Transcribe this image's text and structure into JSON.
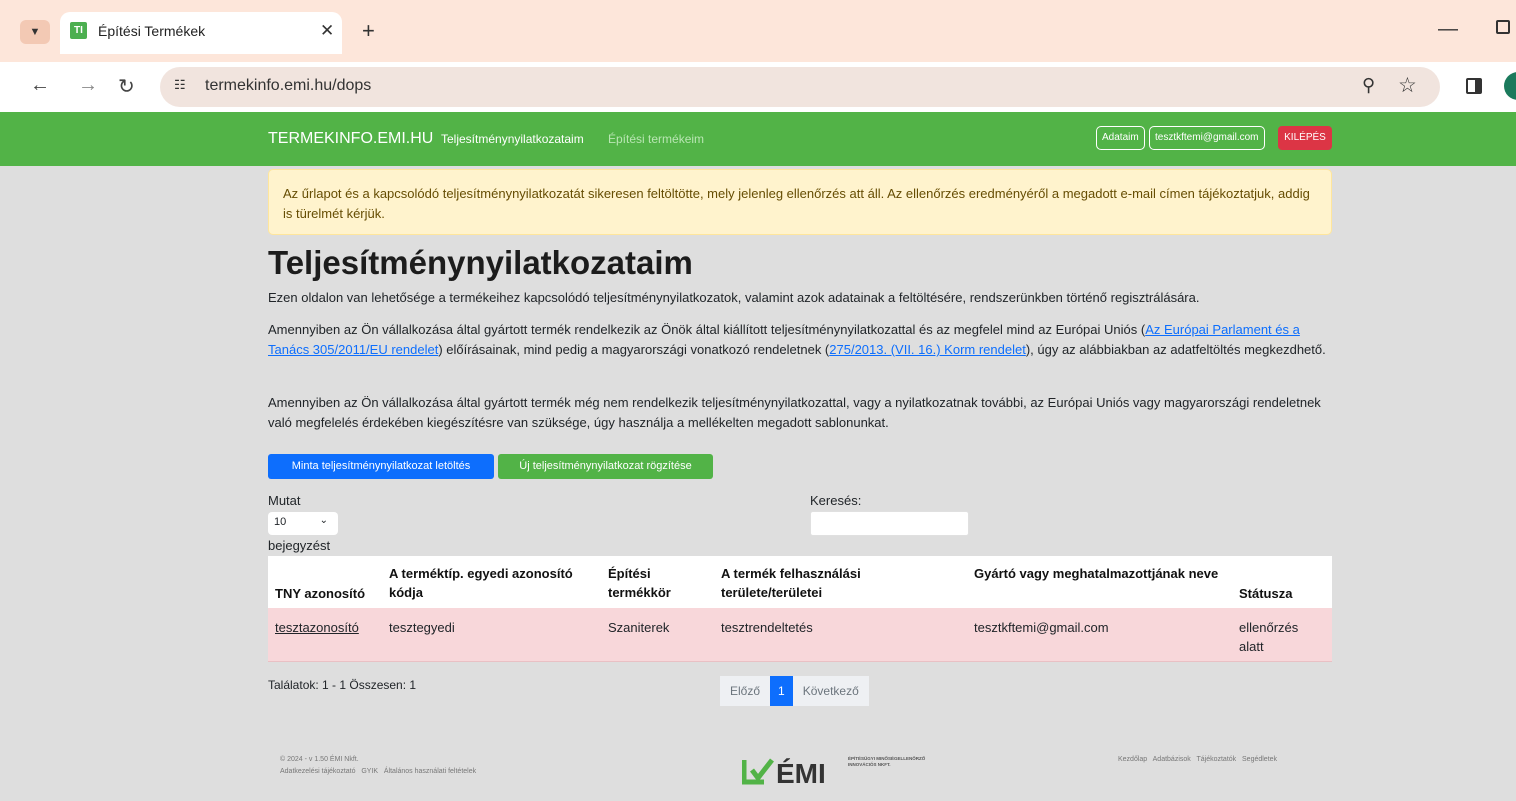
{
  "browser": {
    "tab_title": "Építési Termékek",
    "tab_favicon_text": "TI",
    "url": "termekinfo.emi.hu/dops",
    "icons": [
      "chevron-down-icon",
      "close-icon",
      "plus-icon",
      "minimize-icon",
      "restore-icon",
      "back-icon",
      "forward-icon",
      "reload-icon",
      "site-info-icon",
      "zoom-icon",
      "star-icon",
      "side-panel-icon",
      "profile-icon"
    ]
  },
  "navbar": {
    "brand": "TERMEKINFO.EMI.HU",
    "links": [
      "Teljesítménynyilatkozataim",
      "Építési termékeim"
    ],
    "adataim": "Adataim",
    "email": "tesztkftemi@gmail.com",
    "logout": "KILÉPÉS",
    "color": "#52b347"
  },
  "alert": {
    "text": "Az űrlapot és a kapcsolódó teljesítménynyilatkozatát sikeresen feltöltötte, mely jelenleg ellenőrzés att áll. Az ellenőrzés eredményéről a megadott e-mail címen tájékoztatjuk, addig is türelmét kérjük."
  },
  "page": {
    "title": "Teljesítménynyilatkozataim",
    "intro": "Ezen oldalon van lehetősége a termékeihez kapcsolódó teljesítménynyilatkozatok, valamint azok adatainak a feltöltésére, rendszerünkben történő regisztrálására.",
    "p2_a": "Amennyiben az Ön vállalkozása által gyártott termék rendelkezik az Önök által kiállított teljesítménynyilatkozattal és az megfelel mind az Európai Uniós (",
    "p2_link1": "Az Európai Parlament és a Tanács 305/2011/EU rendelet",
    "p2_b": ") előírásainak, mind pedig a magyarországi vonatkozó rendeletnek (",
    "p2_link2": "275/2013. (VII. 16.) Korm rendelet",
    "p2_c": "), úgy az alábbiakban az adatfeltöltés megkezdhető.",
    "p3": "Amennyiben az Ön vállalkozása által gyártott termék még nem rendelkezik teljesítménynyilatkozattal, vagy a nyilatkozatnak további, az Európai Uniós vagy magyarországi rendeletnek való megfelelés érdekében kiegészítésre van szüksége, úgy használja a mellékelten megadott sablonunkat.",
    "btn_download": "Minta teljesítménynyilatkozat letöltés",
    "btn_new": "Új teljesítménynyilatkozat rögzítése"
  },
  "table_controls": {
    "show_label": "Mutat",
    "page_size": "10",
    "entries_label": "bejegyzést",
    "search_label": "Keresés:"
  },
  "table": {
    "headers": [
      "TNY azonosító",
      "A terméktíp. egyedi azonosító kódja",
      "Építési termékkör",
      "A termék felhasználási területe/területei",
      "Gyártó vagy meghatalmazottjának neve",
      "Státusza"
    ],
    "rows": [
      [
        "tesztazonosító",
        "tesztegyedi",
        "Szaniterek",
        "tesztrendeltetés",
        "tesztkftemi@gmail.com",
        "ellenőrzés alatt"
      ]
    ]
  },
  "pagination": {
    "summary": "Találatok: 1 - 1 Összesen: 1",
    "prev": "Előző",
    "current": "1",
    "next": "Következő"
  },
  "footer": {
    "copyright": "© 2024 - v 1.50 ÉMI Nkft.",
    "left_links": "Adatkezelési tájékoztató   GYIK   Általános használati feltételek",
    "logo_text": "ÉMI",
    "logo_sub": "ÉPÍTÉSÜGYI MINŐSÉGELLENŐRZŐ INNOVÁCIÓS NKFT.",
    "right_links": "Kezdőlap   Adatbázisok   Tájékoztatók   Segédletek"
  }
}
